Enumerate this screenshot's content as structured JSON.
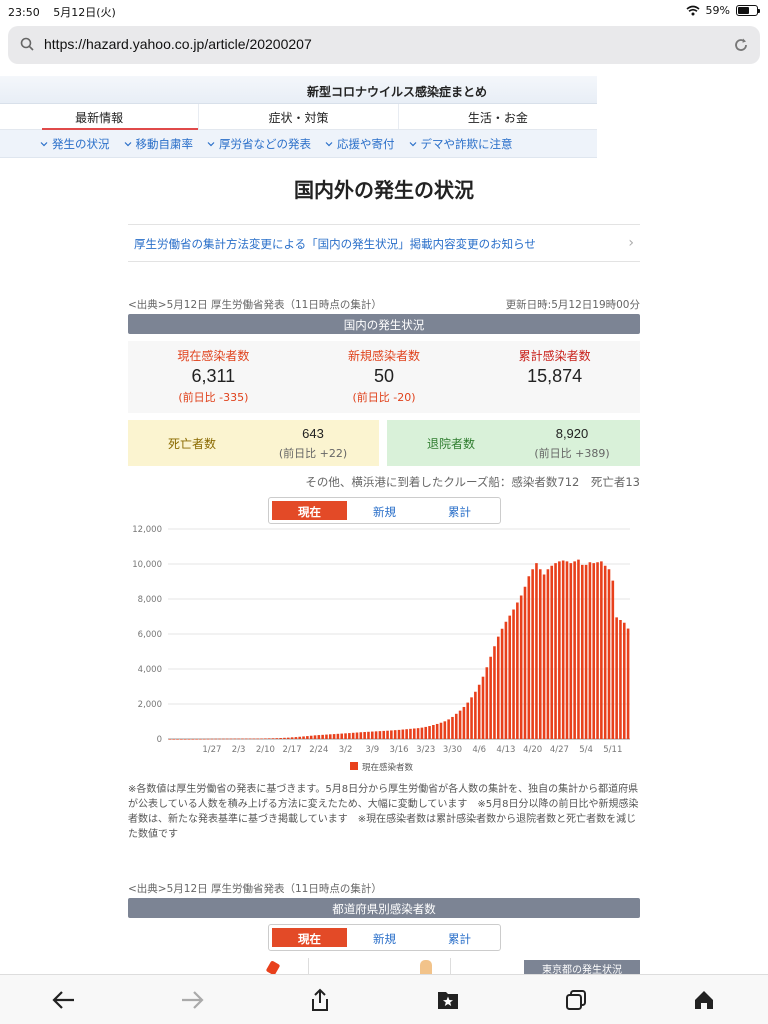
{
  "status_bar": {
    "time": "23:50",
    "date": "5月12日(火)",
    "battery": "59%",
    "battery_level": 0.59
  },
  "url_bar": {
    "url": "https://hazard.yahoo.co.jp/article/20200207"
  },
  "site": {
    "title": "新型コロナウイルス感染症まとめ",
    "tabs": [
      {
        "label": "最新情報",
        "active": true
      },
      {
        "label": "症状・対策"
      },
      {
        "label": "生活・お金"
      }
    ],
    "sub_nav": [
      "発生の状況",
      "移動自粛率",
      "厚労省などの発表",
      "応援や寄付",
      "デマや詐欺に注意"
    ]
  },
  "page": {
    "title": "国内外の発生の状況",
    "notice": "厚生労働省の集計方法変更による「国内の発生状況」掲載内容変更のお知らせ",
    "source": "<出典>5月12日 厚生労働省発表（11日時点の集計）",
    "updated": "更新日時:5月12日19時00分",
    "section_domestic": "国内の発生状況",
    "stats": [
      {
        "label": "現在感染者数",
        "value": "6,311",
        "diff": "(前日比 -335)"
      },
      {
        "label": "新規感染者数",
        "value": "50",
        "diff": "(前日比 -20)"
      },
      {
        "label": "累計感染者数",
        "value": "15,874",
        "diff": ""
      }
    ],
    "deaths": {
      "label": "死亡者数",
      "value": "643",
      "diff": "(前日比 +22)"
    },
    "recovered": {
      "label": "退院者数",
      "value": "8,920",
      "diff": "(前日比 +389)"
    },
    "other": "その他、横浜港に到着したクルーズ船：感染者数712　死亡者13",
    "toggle": [
      "現在",
      "新規",
      "累計"
    ],
    "footnote": "※各数値は厚生労働省の発表に基づきます。5月8日分から厚生労働省が各人数の集計を、独自の集計から都道府県が公表している人数を積み上げる方法に変えたため、大幅に変動しています　※5月8日分以降の前日比や新規感染者数は、新たな発表基準に基づき掲載しています　※現在感染者数は累計感染者数から退院者数と死亡者数を減じた数値です",
    "source2": "<出典>5月12日 厚生労働省発表（11日時点の集計）",
    "section_prefecture": "都道府県別感染者数",
    "toggle2": [
      "現在",
      "新規",
      "累計"
    ],
    "tokyo_badge": "東京都の発生状況"
  },
  "chart_data": {
    "type": "bar",
    "ylim": [
      0,
      12000
    ],
    "yticks": [
      0,
      2000,
      4000,
      6000,
      8000,
      10000,
      12000
    ],
    "ytick_labels": [
      "0",
      "2,000",
      "4,000",
      "6,000",
      "8,000",
      "10,000",
      "12,000"
    ],
    "xtick_labels": [
      "1/27",
      "2/3",
      "2/10",
      "2/17",
      "2/24",
      "3/2",
      "3/9",
      "3/16",
      "3/23",
      "3/30",
      "4/6",
      "4/13",
      "4/20",
      "4/27",
      "5/4",
      "5/11"
    ],
    "legend": "現在感染者数",
    "color": "#e8401c",
    "start_date": "1/16",
    "values": [
      1,
      1,
      1,
      1,
      1,
      3,
      3,
      4,
      5,
      7,
      11,
      14,
      15,
      17,
      18,
      19,
      20,
      23,
      23,
      24,
      24,
      25,
      25,
      26,
      28,
      33,
      38,
      42,
      48,
      57,
      68,
      77,
      96,
      110,
      128,
      147,
      166,
      187,
      208,
      224,
      238,
      253,
      268,
      281,
      296,
      310,
      324,
      338,
      355,
      370,
      386,
      400,
      412,
      425,
      438,
      450,
      462,
      475,
      490,
      505,
      520,
      540,
      560,
      580,
      600,
      620,
      650,
      690,
      740,
      800,
      860,
      930,
      1010,
      1120,
      1260,
      1440,
      1620,
      1830,
      2080,
      2380,
      2700,
      3100,
      3560,
      4100,
      4700,
      5300,
      5850,
      6300,
      6700,
      7050,
      7400,
      7800,
      8200,
      8700,
      9300,
      9700,
      10050,
      9700,
      9400,
      9700,
      9900,
      10050,
      10150,
      10200,
      10150,
      10050,
      10150,
      10250,
      9950,
      9950,
      10100,
      10050,
      10100,
      10150,
      9900,
      9700,
      9050,
      6950,
      6800,
      6645,
      6311
    ]
  }
}
